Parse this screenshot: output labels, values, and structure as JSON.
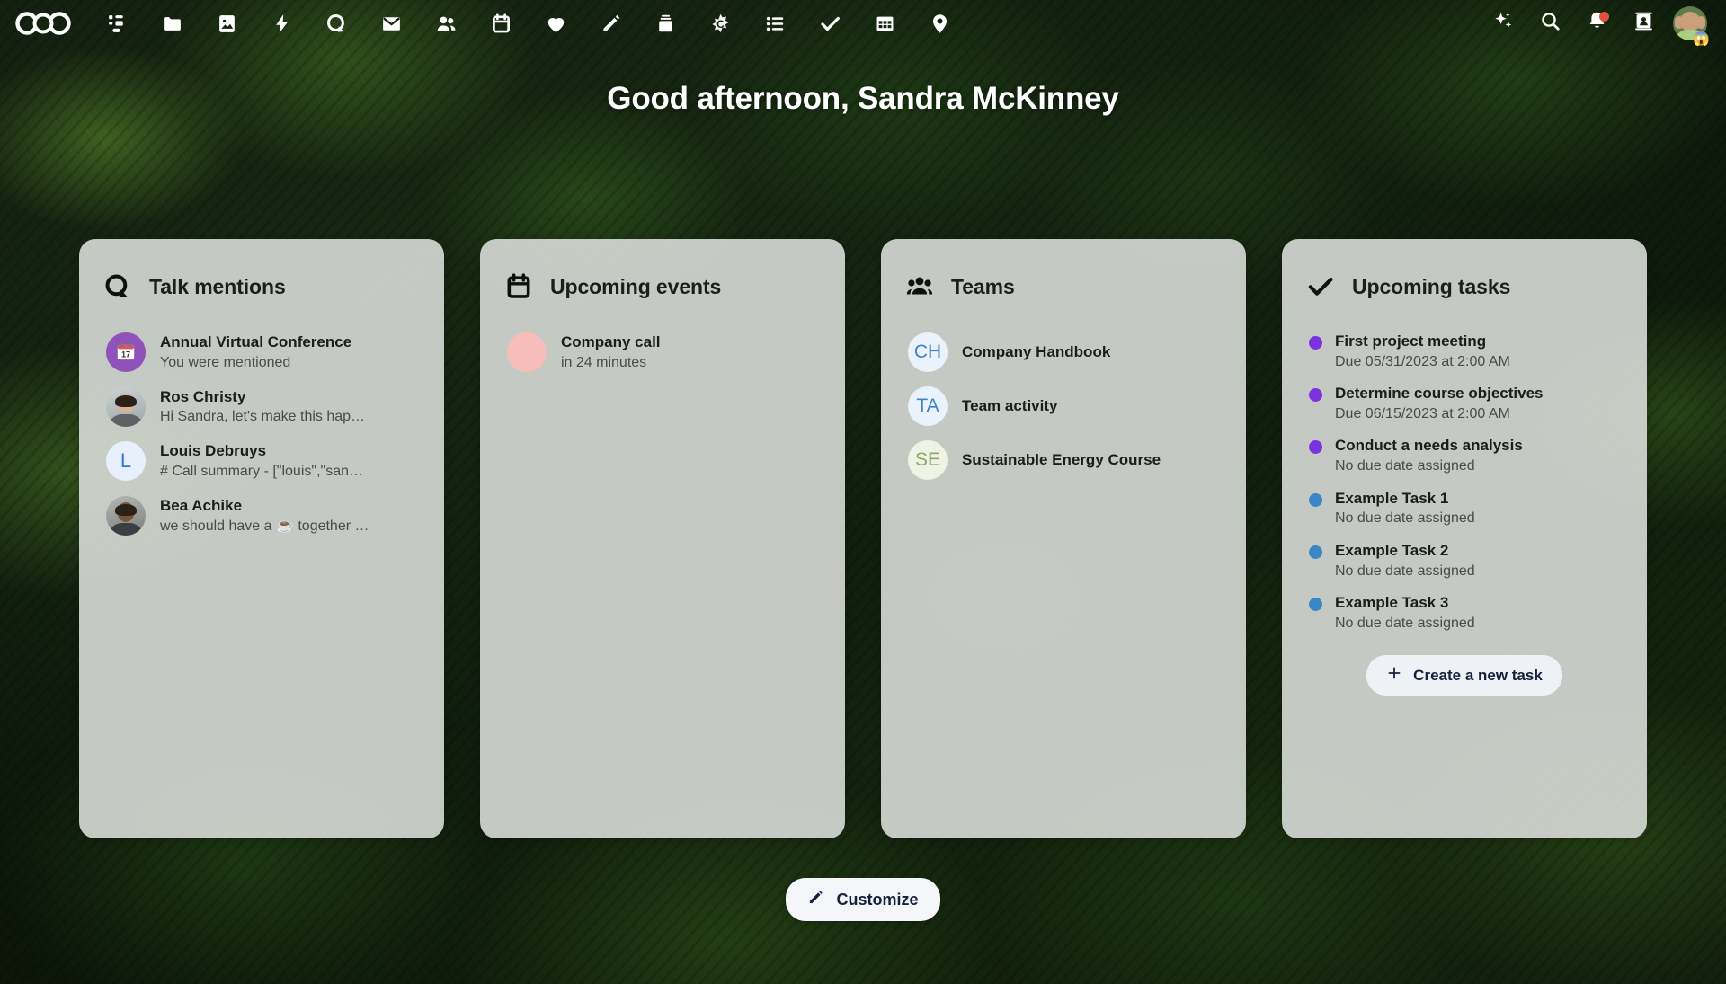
{
  "header": {
    "logo_name": "nextcloud-logo",
    "apps": [
      {
        "name": "dashboard",
        "label": "Dashboard",
        "icon": "dashboard-icon"
      },
      {
        "name": "files",
        "label": "Files",
        "icon": "folder-icon"
      },
      {
        "name": "photos",
        "label": "Photos",
        "icon": "image-icon"
      },
      {
        "name": "activity",
        "label": "Activity",
        "icon": "lightning-icon"
      },
      {
        "name": "talk",
        "label": "Talk",
        "icon": "talk-icon"
      },
      {
        "name": "mail",
        "label": "Mail",
        "icon": "mail-icon"
      },
      {
        "name": "contacts",
        "label": "Contacts",
        "icon": "contacts-icon"
      },
      {
        "name": "calendar",
        "label": "Calendar",
        "icon": "calendar-icon"
      },
      {
        "name": "health",
        "label": "Health",
        "icon": "heart-icon"
      },
      {
        "name": "notes",
        "label": "Notes",
        "icon": "pencil-icon"
      },
      {
        "name": "deck",
        "label": "Deck",
        "icon": "deck-icon"
      },
      {
        "name": "collectives",
        "label": "Collectives",
        "icon": "collectives-icon"
      },
      {
        "name": "lists",
        "label": "Lists",
        "icon": "list-icon"
      },
      {
        "name": "tasks",
        "label": "Tasks",
        "icon": "check-icon"
      },
      {
        "name": "tables",
        "label": "Tables",
        "icon": "grid-icon"
      },
      {
        "name": "maps",
        "label": "Maps",
        "icon": "map-pin-icon"
      }
    ],
    "right": [
      {
        "name": "assistant",
        "label": "Assistant",
        "icon": "sparkles-icon"
      },
      {
        "name": "search",
        "label": "Search",
        "icon": "magnify-icon"
      },
      {
        "name": "notifications",
        "label": "Notifications",
        "icon": "bell-icon",
        "badge": true
      },
      {
        "name": "contacts-menu",
        "label": "Contacts menu",
        "icon": "contacts-card-icon"
      }
    ],
    "avatar": {
      "name": "Sandra McKinney",
      "status_emoji": "😱"
    }
  },
  "greeting": "Good afternoon, Sandra McKinney",
  "widgets": {
    "talk": {
      "title": "Talk mentions",
      "icon": "talk-icon",
      "items": [
        {
          "title": "Annual Virtual Conference",
          "subtitle": "You were mentioned",
          "avatar": "calendar-badge"
        },
        {
          "title": "Ros Christy",
          "subtitle": "Hi Sandra, let's make this hap…",
          "avatar": "photo-light"
        },
        {
          "title": "Louis Debruys",
          "subtitle": "# Call summary - [\"louis\",\"san…",
          "avatar": "letter",
          "initial": "L"
        },
        {
          "title": "Bea Achike",
          "subtitle": "we should have a ☕ together …",
          "avatar": "photo-dark"
        }
      ]
    },
    "events": {
      "title": "Upcoming events",
      "icon": "calendar-icon",
      "items": [
        {
          "title": "Company call",
          "subtitle": "in 24 minutes",
          "avatar": "event-dot",
          "color": "#f6bdbb"
        }
      ]
    },
    "teams": {
      "title": "Teams",
      "icon": "contacts-icon",
      "items": [
        {
          "title": "Company Handbook",
          "initials": "CH",
          "color": "#4184c4"
        },
        {
          "title": "Team activity",
          "initials": "TA",
          "color": "#4184c4"
        },
        {
          "title": "Sustainable Energy Course",
          "initials": "SE",
          "color": "#8aa86a"
        }
      ]
    },
    "tasks": {
      "title": "Upcoming tasks",
      "icon": "check-icon",
      "items": [
        {
          "title": "First project meeting",
          "subtitle": "Due 05/31/2023 at 2:00 AM",
          "dot_color": "#7b33e0"
        },
        {
          "title": "Determine course objectives",
          "subtitle": "Due 06/15/2023 at 2:00 AM",
          "dot_color": "#7b33e0"
        },
        {
          "title": "Conduct a needs analysis",
          "subtitle": "No due date assigned",
          "dot_color": "#7b33e0"
        },
        {
          "title": "Example Task 1",
          "subtitle": "No due date assigned",
          "dot_color": "#3a87c8"
        },
        {
          "title": "Example Task 2",
          "subtitle": "No due date assigned",
          "dot_color": "#3a87c8"
        },
        {
          "title": "Example Task 3",
          "subtitle": "No due date assigned",
          "dot_color": "#3a87c8"
        }
      ],
      "create_label": "Create a new task",
      "create_icon": "plus-icon"
    }
  },
  "customize": {
    "label": "Customize",
    "icon": "pencil-icon"
  },
  "colors": {
    "card_bg": "#dee0dd",
    "accent_purple": "#7b33e0",
    "accent_blue": "#3a87c8",
    "badge_red": "#e4513b",
    "button_bg": "#f4f6fa",
    "button_text": "#16203a"
  }
}
